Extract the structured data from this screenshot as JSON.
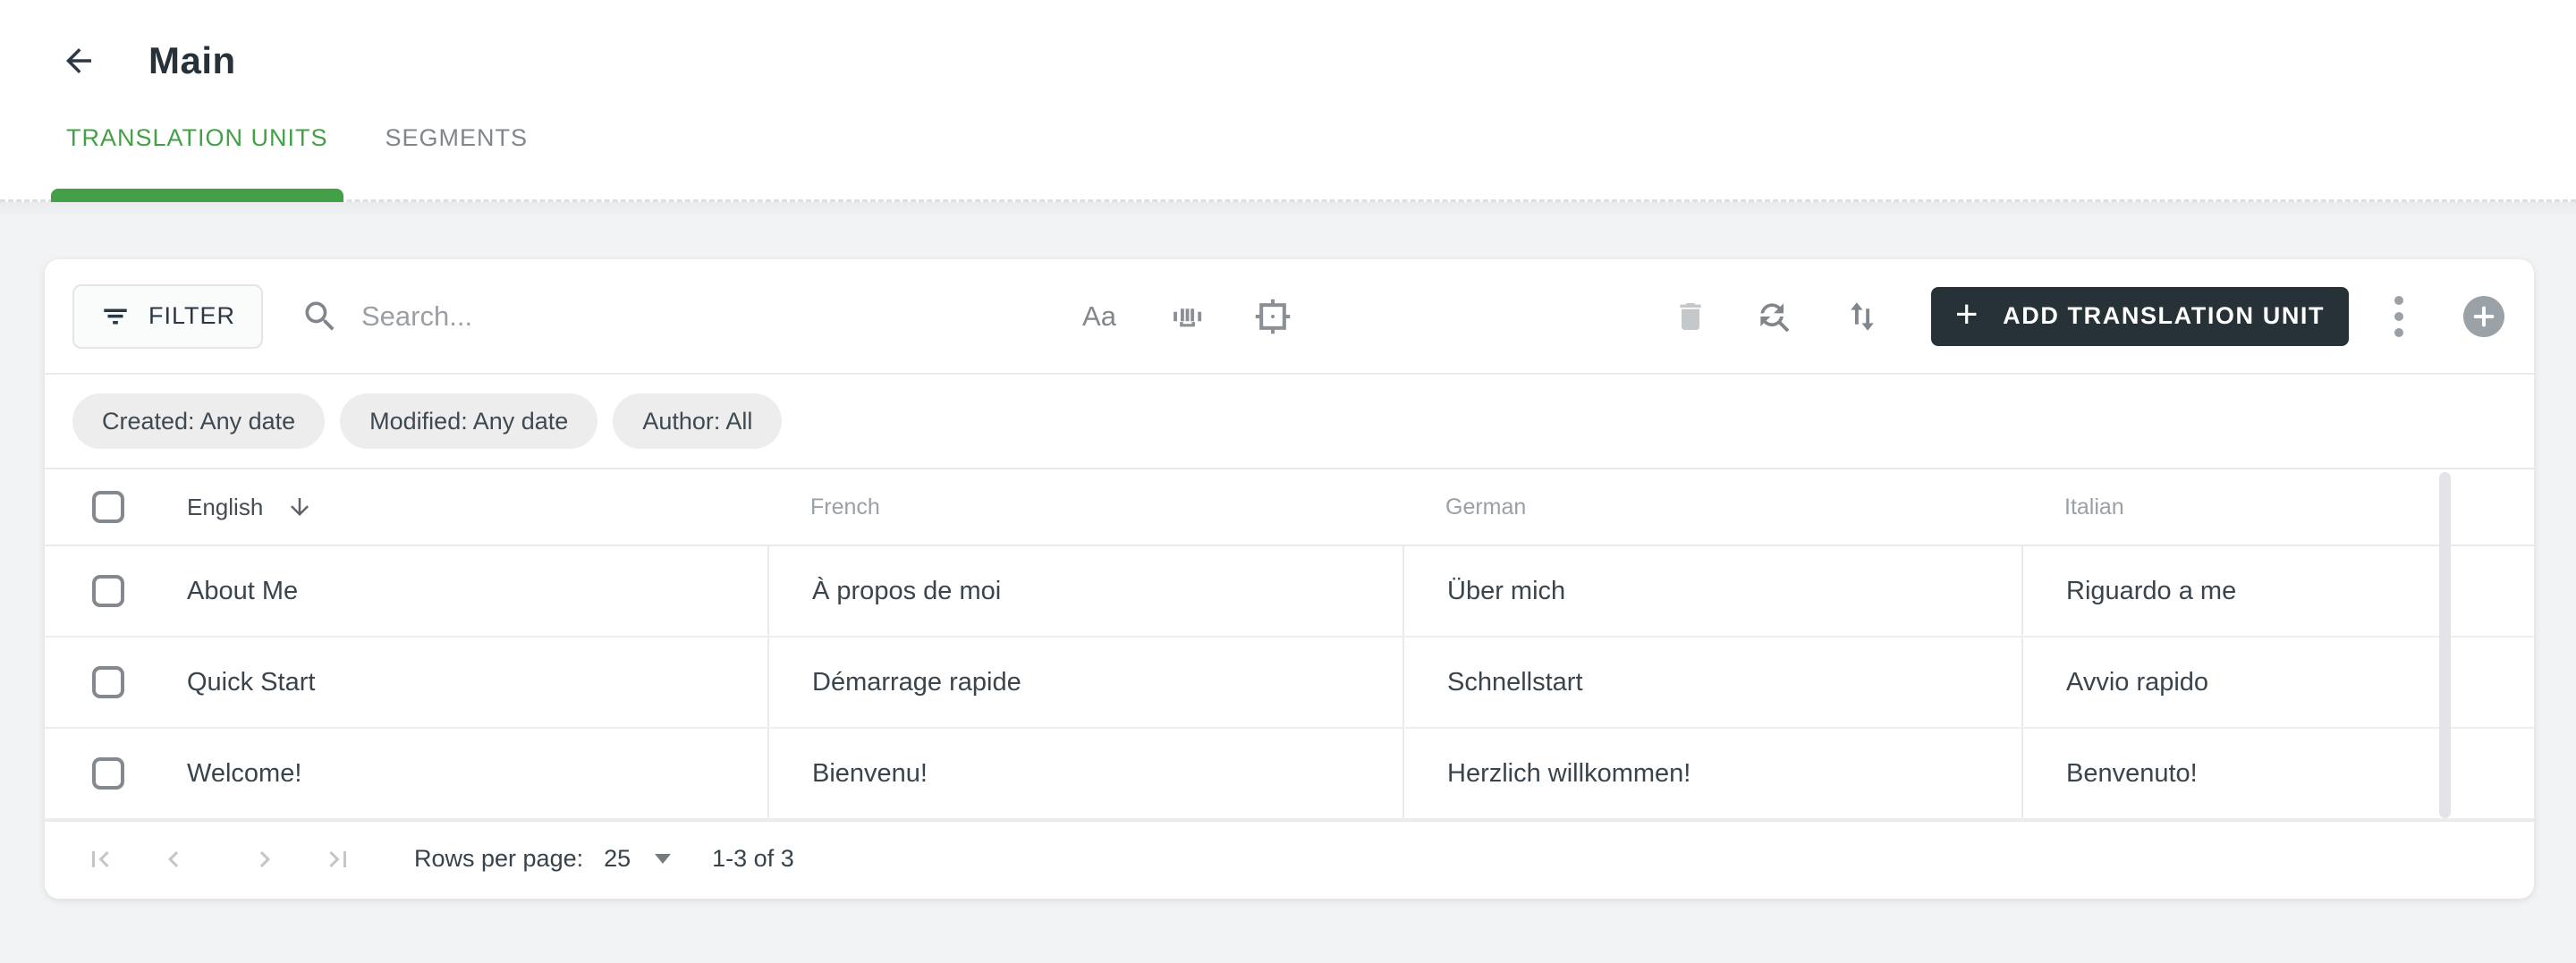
{
  "header": {
    "title": "Main"
  },
  "tabs": [
    {
      "label": "TRANSLATION UNITS",
      "active": true
    },
    {
      "label": "SEGMENTS",
      "active": false
    }
  ],
  "toolbar": {
    "filter_label": "FILTER",
    "search_placeholder": "Search...",
    "match_case_label": "Aa",
    "add_button_plus": "+",
    "add_button_label": "ADD TRANSLATION UNIT"
  },
  "filter_chips": [
    {
      "label": "Created: Any date"
    },
    {
      "label": "Modified: Any date"
    },
    {
      "label": "Author: All"
    }
  ],
  "table": {
    "columns": [
      "English",
      "French",
      "German",
      "Italian"
    ],
    "sort": {
      "column": "English",
      "direction": "down"
    },
    "rows": [
      {
        "english": "About Me",
        "french": "À propos de moi",
        "german": "Über mich",
        "italian": "Riguardo a me"
      },
      {
        "english": "Quick Start",
        "french": "Démarrage rapide",
        "german": "Schnellstart",
        "italian": "Avvio rapido"
      },
      {
        "english": "Welcome!",
        "french": "Bienvenu!",
        "german": "Herzlich willkommen!",
        "italian": "Benvenuto!"
      }
    ]
  },
  "pagination": {
    "rows_per_page_label": "Rows per page:",
    "rows_per_page_value": "25",
    "range_label": "1-3 of 3"
  },
  "icons": {
    "back": "arrow-left",
    "filter": "filter-list",
    "search": "magnifier",
    "whole_word": "barcode-brackets",
    "selection": "frame-crosshair-dot",
    "delete": "trash",
    "find_replace": "circular-arrows-magnifier",
    "sort": "up-down-arrows",
    "more": "kebab-vertical-dots",
    "add_circle": "plus-in-circle",
    "pager": [
      "first-page",
      "chevron-left",
      "chevron-right",
      "last-page"
    ]
  },
  "colors": {
    "accent_green": "#43a047",
    "button_dark": "#263238",
    "page_background": "#f1f3f4",
    "chip_background": "#ededee"
  }
}
